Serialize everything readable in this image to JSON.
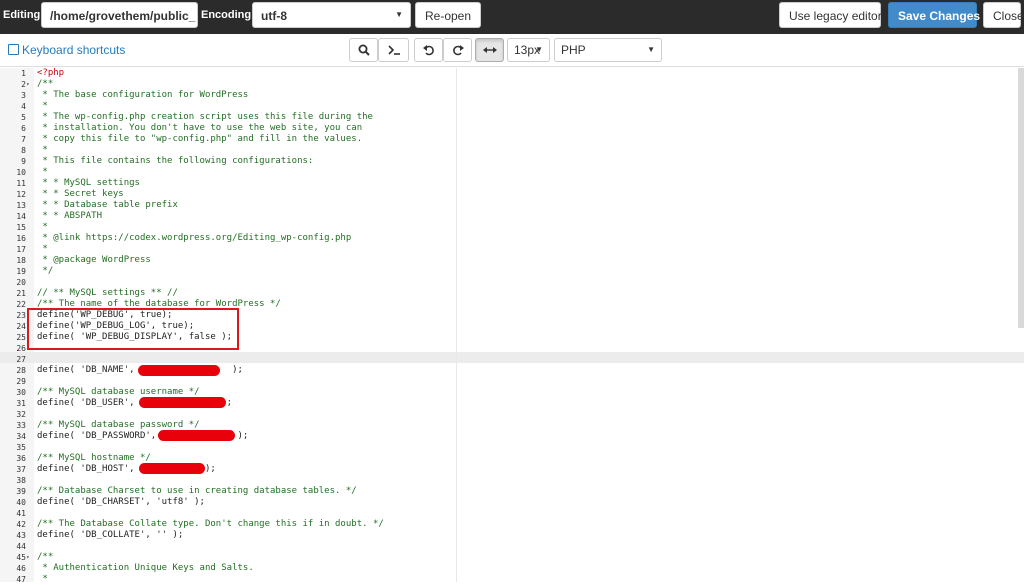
{
  "topbar": {
    "editing_label": "Editing:",
    "file_path": "/home/grovethem/public_",
    "encoding_label": "Encoding:",
    "encoding_value": "utf-8",
    "reopen_label": "Re-open",
    "legacy_label": "Use legacy editor",
    "save_label": "Save Changes",
    "close_label": "Close"
  },
  "toolbar": {
    "shortcuts_label": "Keyboard shortcuts",
    "font_size": "13px",
    "mode": "PHP"
  },
  "editor": {
    "lines": [
      {
        "n": "1",
        "fold": "",
        "text": "<?php",
        "cls": "php"
      },
      {
        "n": "2",
        "fold": "▾",
        "text": "/**",
        "cls": "cm"
      },
      {
        "n": "3",
        "fold": "",
        "text": " * The base configuration for WordPress",
        "cls": "cm"
      },
      {
        "n": "4",
        "fold": "",
        "text": " *",
        "cls": "cm"
      },
      {
        "n": "5",
        "fold": "",
        "text": " * The wp-config.php creation script uses this file during the",
        "cls": "cm"
      },
      {
        "n": "6",
        "fold": "",
        "text": " * installation. You don't have to use the web site, you can",
        "cls": "cm"
      },
      {
        "n": "7",
        "fold": "",
        "text": " * copy this file to \"wp-config.php\" and fill in the values.",
        "cls": "cm"
      },
      {
        "n": "8",
        "fold": "",
        "text": " *",
        "cls": "cm"
      },
      {
        "n": "9",
        "fold": "",
        "text": " * This file contains the following configurations:",
        "cls": "cm"
      },
      {
        "n": "10",
        "fold": "",
        "text": " *",
        "cls": "cm"
      },
      {
        "n": "11",
        "fold": "",
        "text": " * * MySQL settings",
        "cls": "cm"
      },
      {
        "n": "12",
        "fold": "",
        "text": " * * Secret keys",
        "cls": "cm"
      },
      {
        "n": "13",
        "fold": "",
        "text": " * * Database table prefix",
        "cls": "cm"
      },
      {
        "n": "14",
        "fold": "",
        "text": " * * ABSPATH",
        "cls": "cm"
      },
      {
        "n": "15",
        "fold": "",
        "text": " *",
        "cls": "cm"
      },
      {
        "n": "16",
        "fold": "",
        "text": " * @link https://codex.wordpress.org/Editing_wp-config.php",
        "cls": "cm"
      },
      {
        "n": "17",
        "fold": "",
        "text": " *",
        "cls": "cm"
      },
      {
        "n": "18",
        "fold": "",
        "text": " * @package WordPress",
        "cls": "cm"
      },
      {
        "n": "19",
        "fold": "",
        "text": " */",
        "cls": "cm"
      },
      {
        "n": "20",
        "fold": "",
        "text": "",
        "cls": ""
      },
      {
        "n": "21",
        "fold": "",
        "text": "// ** MySQL settings ** //",
        "cls": "cm"
      },
      {
        "n": "22",
        "fold": "",
        "text": "/** The name of the database for WordPress */",
        "cls": "cm"
      },
      {
        "n": "23",
        "fold": "",
        "text": "define('WP_DEBUG', true);",
        "cls": ""
      },
      {
        "n": "24",
        "fold": "",
        "text": "define('WP_DEBUG_LOG', true);",
        "cls": ""
      },
      {
        "n": "25",
        "fold": "",
        "text": "define( 'WP_DEBUG_DISPLAY', false );",
        "cls": ""
      },
      {
        "n": "26",
        "fold": "",
        "text": "",
        "cls": ""
      },
      {
        "n": "27",
        "fold": "",
        "text": "",
        "cls": ""
      },
      {
        "n": "28",
        "fold": "",
        "text": "define( 'DB_NAME',                  );",
        "cls": ""
      },
      {
        "n": "29",
        "fold": "",
        "text": "",
        "cls": ""
      },
      {
        "n": "30",
        "fold": "",
        "text": "/** MySQL database username */",
        "cls": "cm"
      },
      {
        "n": "31",
        "fold": "",
        "text": "define( 'DB_USER',                );",
        "cls": ""
      },
      {
        "n": "32",
        "fold": "",
        "text": "",
        "cls": ""
      },
      {
        "n": "33",
        "fold": "",
        "text": "/** MySQL database password */",
        "cls": "cm"
      },
      {
        "n": "34",
        "fold": "",
        "text": "define( 'DB_PASSWORD',               );",
        "cls": ""
      },
      {
        "n": "35",
        "fold": "",
        "text": "",
        "cls": ""
      },
      {
        "n": "36",
        "fold": "",
        "text": "/** MySQL hostname */",
        "cls": "cm"
      },
      {
        "n": "37",
        "fold": "",
        "text": "define( 'DB_HOST',             );",
        "cls": ""
      },
      {
        "n": "38",
        "fold": "",
        "text": "",
        "cls": ""
      },
      {
        "n": "39",
        "fold": "",
        "text": "/** Database Charset to use in creating database tables. */",
        "cls": "cm"
      },
      {
        "n": "40",
        "fold": "",
        "text": "define( 'DB_CHARSET', 'utf8' );",
        "cls": ""
      },
      {
        "n": "41",
        "fold": "",
        "text": "",
        "cls": ""
      },
      {
        "n": "42",
        "fold": "",
        "text": "/** The Database Collate type. Don't change this if in doubt. */",
        "cls": "cm"
      },
      {
        "n": "43",
        "fold": "",
        "text": "define( 'DB_COLLATE', '' );",
        "cls": ""
      },
      {
        "n": "44",
        "fold": "",
        "text": "",
        "cls": ""
      },
      {
        "n": "45",
        "fold": "▾",
        "text": "/**",
        "cls": "cm"
      },
      {
        "n": "46",
        "fold": "",
        "text": " * Authentication Unique Keys and Salts.",
        "cls": "cm"
      },
      {
        "n": "47",
        "fold": "",
        "text": " *",
        "cls": "cm"
      }
    ]
  }
}
